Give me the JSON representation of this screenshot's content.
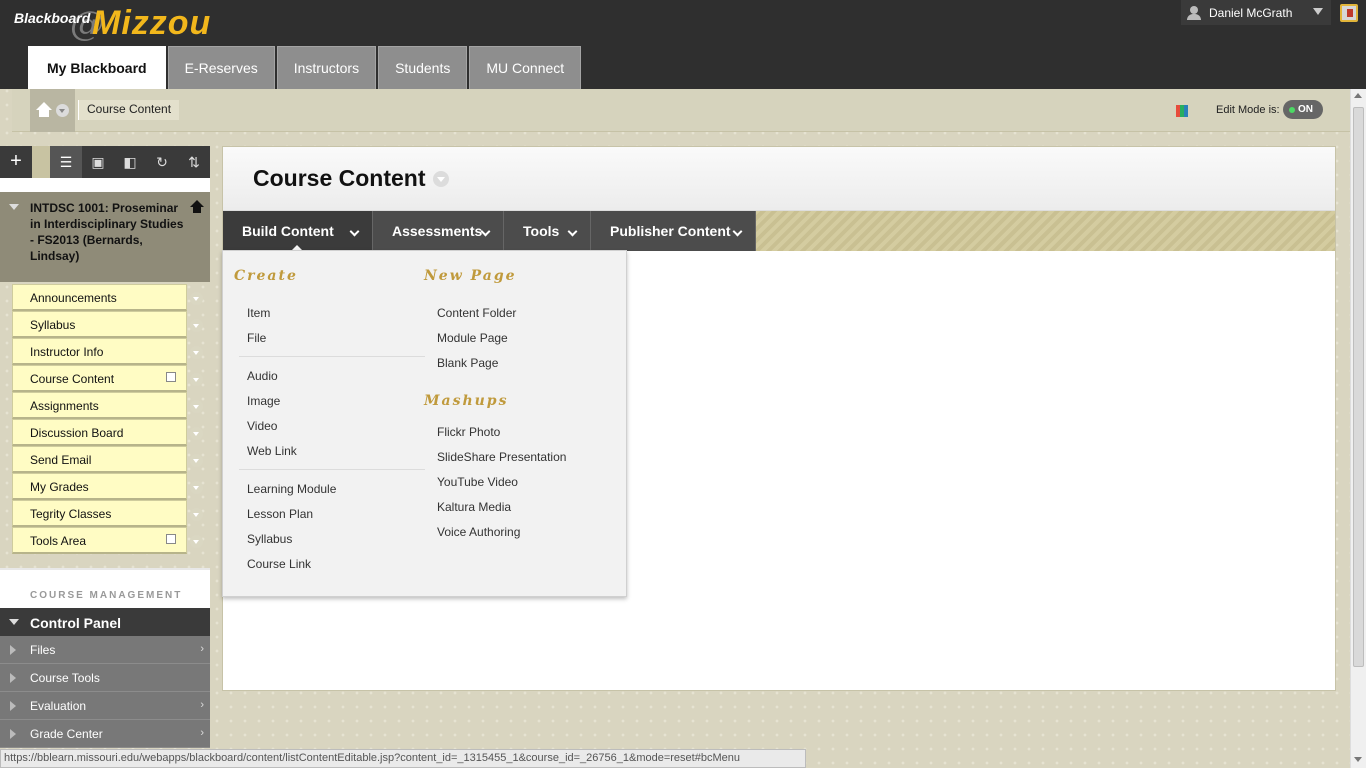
{
  "header": {
    "logo_small": "Blackboard",
    "logo_at": "@",
    "logo_big": "Mizzou",
    "user_name": "Daniel McGrath"
  },
  "tabs": [
    {
      "label": "My Blackboard",
      "active": true
    },
    {
      "label": "E-Reserves"
    },
    {
      "label": "Instructors"
    },
    {
      "label": "Students"
    },
    {
      "label": "MU Connect"
    }
  ],
  "breadcrumb": {
    "current": "Course Content"
  },
  "edit_mode": {
    "label": "Edit Mode is:",
    "state": "ON"
  },
  "sidebar": {
    "add_label": "+",
    "course_title": "INTDSC 1001: Proseminar in Interdisciplinary Studies - FS2013 (Bernards, Lindsay)",
    "menu_items": [
      "Announcements",
      "Syllabus",
      "Instructor Info",
      "Course Content",
      "Assignments",
      "Discussion Board",
      "Send Email",
      "My Grades",
      "Tegrity Classes",
      "Tools Area"
    ],
    "course_management_label": "COURSE MANAGEMENT",
    "control_panel_label": "Control Panel",
    "control_panel_items": [
      "Files",
      "Course Tools",
      "Evaluation",
      "Grade Center"
    ]
  },
  "main": {
    "page_title": "Course Content",
    "action_buttons": [
      "Build Content",
      "Assessments",
      "Tools",
      "Publisher Content"
    ]
  },
  "build_menu": {
    "create_heading": "Create",
    "create_group1": [
      "Item",
      "File"
    ],
    "create_group2": [
      "Audio",
      "Image",
      "Video",
      "Web Link"
    ],
    "create_group3": [
      "Learning Module",
      "Lesson Plan",
      "Syllabus",
      "Course Link"
    ],
    "new_page_heading": "New Page",
    "new_page_items": [
      "Content Folder",
      "Module Page",
      "Blank Page"
    ],
    "mashups_heading": "Mashups",
    "mashups_items": [
      "Flickr Photo",
      "SlideShare Presentation",
      "YouTube Video",
      "Kaltura Media",
      "Voice Authoring"
    ]
  },
  "status_bar": {
    "url": "https://bblearn.missouri.edu/webapps/blackboard/content/listContentEditable.jsp?content_id=_1315455_1&course_id=_26756_1&mode=reset#bcMenu"
  },
  "icons": {
    "user": "user-icon",
    "logout": "logout-icon",
    "home": "home-icon",
    "palette": "palette-icon",
    "toolbar": [
      "folder-view-icon",
      "folder-icon",
      "window-icon",
      "refresh-icon",
      "sort-icon"
    ]
  },
  "colors": {
    "topbar": "#2f2f2f",
    "accent_gold": "#f2b71c",
    "menu_heading": "#c09a3c",
    "menu_item_bg": "#fffcc4",
    "action_bar": "#4c4c4c",
    "toggle_on": "#4cd964"
  }
}
